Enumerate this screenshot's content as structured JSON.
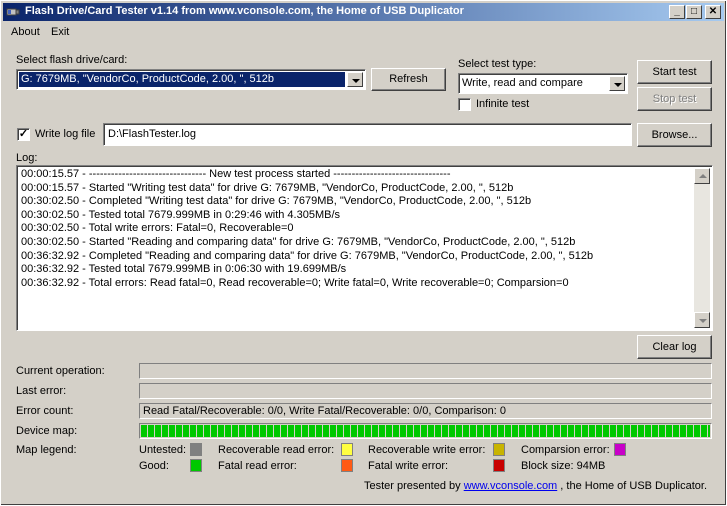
{
  "window": {
    "title": "Flash Drive/Card Tester v1.14 from www.vconsole.com, the Home of USB Duplicator",
    "minimize": "_",
    "maximize": "□",
    "close": "✕"
  },
  "menu": {
    "about": "About",
    "exit": "Exit"
  },
  "drive": {
    "label": "Select flash drive/card:",
    "selected": "G: 7679MB, \"VendorCo, ProductCode, 2.00, \", 512b",
    "refresh": "Refresh"
  },
  "test_type": {
    "label": "Select test type:",
    "selected": "Write, read and compare",
    "infinite_label": "Infinite test",
    "infinite_checked": false
  },
  "buttons": {
    "start": "Start test",
    "stop": "Stop test",
    "browse": "Browse...",
    "clear_log": "Clear log"
  },
  "write_log": {
    "label": "Write log file",
    "checked": true,
    "path": "D:\\FlashTester.log"
  },
  "log": {
    "label": "Log:",
    "lines": [
      "00:00:15.57 - -------------------------------- New test process started --------------------------------",
      "00:00:15.57 - Started \"Writing test data\" for drive G: 7679MB, \"VendorCo, ProductCode, 2.00, \", 512b",
      "00:30:02.50 - Completed \"Writing test data\" for drive G: 7679MB, \"VendorCo, ProductCode, 2.00, \", 512b",
      "00:30:02.50 - Tested total 7679.999MB in 0:29:46 with  4.305MB/s",
      "00:30:02.50 - Total write errors: Fatal=0, Recoverable=0",
      "00:30:02.50 - Started \"Reading and comparing data\" for drive G: 7679MB, \"VendorCo, ProductCode, 2.00, \", 512b",
      "00:36:32.92 - Completed \"Reading and comparing data\" for drive G: 7679MB, \"VendorCo, ProductCode, 2.00, \", 512b",
      "00:36:32.92 - Tested total 7679.999MB in 0:06:30 with 19.699MB/s",
      "00:36:32.92 - Total errors: Read fatal=0, Read recoverable=0; Write fatal=0, Write recoverable=0; Comparsion=0"
    ]
  },
  "status": {
    "current_operation_label": "Current operation:",
    "current_operation": "",
    "last_error_label": "Last error:",
    "last_error": "",
    "error_count_label": "Error count:",
    "error_count": "Read Fatal/Recoverable: 0/0, Write Fatal/Recoverable: 0/0, Comparison: 0",
    "device_map_label": "Device map:",
    "device_map_good_fraction": 1.0,
    "device_map_color": "#00c800"
  },
  "legend": {
    "label": "Map legend:",
    "items": [
      {
        "label": "Untested:",
        "color": "#808080"
      },
      {
        "label": "Recoverable read error:",
        "color": "#ffff40"
      },
      {
        "label": "Recoverable write error:",
        "color": "#c8b400"
      },
      {
        "label": "Comparsion error:",
        "color": "#c800c8"
      },
      {
        "label": "Good:",
        "color": "#00c800"
      },
      {
        "label": "Fatal read error:",
        "color": "#ff5a14"
      },
      {
        "label": "Fatal write error:",
        "color": "#c80000"
      }
    ],
    "block_size": "Block size: 94MB"
  },
  "footer": {
    "prefix": "Tester presented by",
    "link": "www.vconsole.com",
    "suffix": ", the Home of USB Duplicator."
  }
}
